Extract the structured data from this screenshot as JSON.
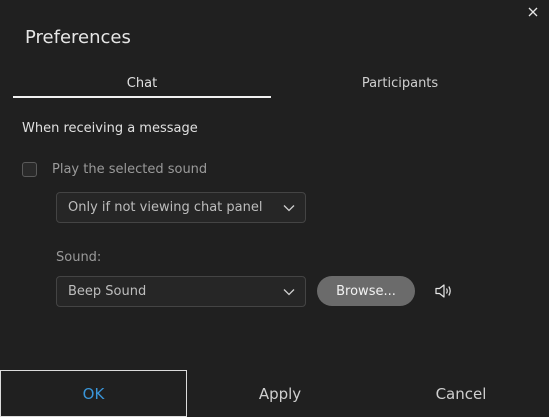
{
  "dialog": {
    "title": "Preferences",
    "close_icon": "close-icon"
  },
  "tabs": [
    {
      "label": "Chat",
      "active": true
    },
    {
      "label": "Participants",
      "active": false
    }
  ],
  "chat": {
    "section_label": "When receiving a message",
    "play_sound": {
      "label": "Play the selected sound",
      "checked": false
    },
    "when_select": {
      "value": "Only if not viewing chat panel"
    },
    "sound_label": "Sound:",
    "sound_select": {
      "value": "Beep Sound"
    },
    "browse_label": "Browse...",
    "speaker_icon": "speaker-icon"
  },
  "footer": {
    "ok_label": "OK",
    "apply_label": "Apply",
    "cancel_label": "Cancel"
  },
  "colors": {
    "background": "#202020",
    "accent": "#3a95d8",
    "browse_button": "#6b6b6b"
  }
}
